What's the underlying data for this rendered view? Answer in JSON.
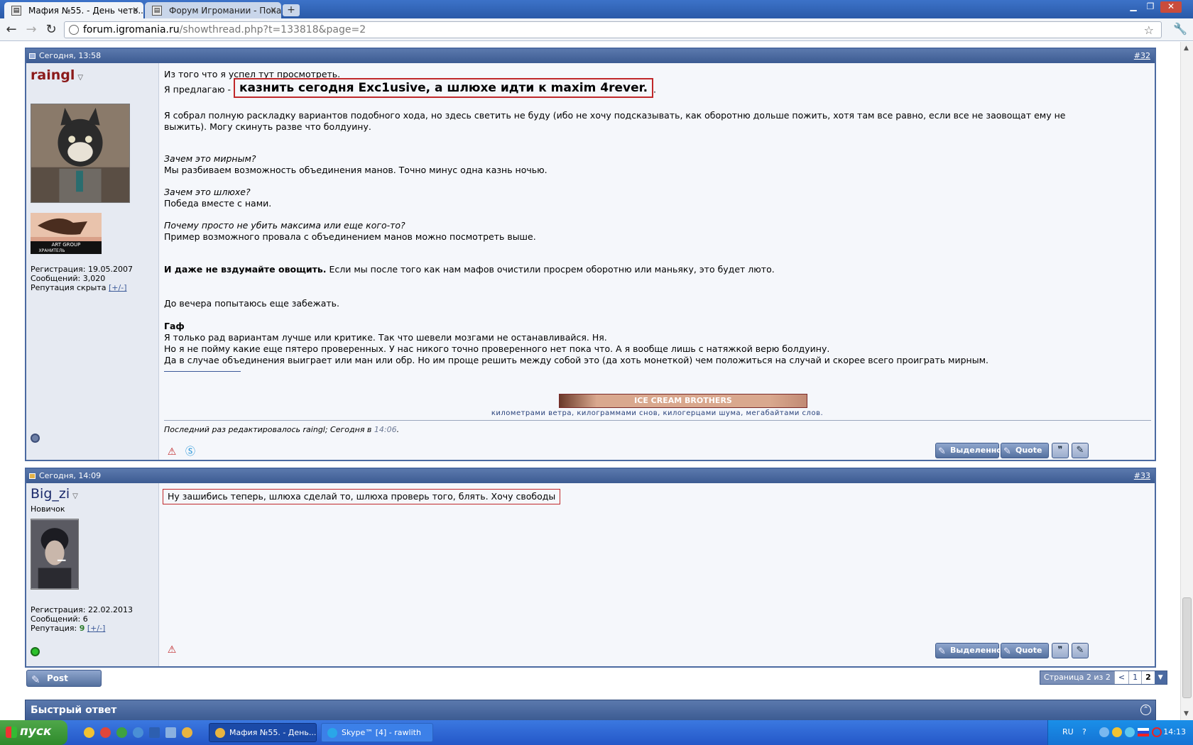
{
  "browser": {
    "tabs": [
      {
        "label": "Мафия №55. - День четв..."
      },
      {
        "label": "Форум Игромании - Показ..."
      }
    ],
    "url_host": "forum.igromania.ru",
    "url_path": "/showthread.php?t=133818&page=2"
  },
  "posts": [
    {
      "date": "Сегодня, 13:58",
      "number": "#32",
      "user": {
        "name": "raingl",
        "registration": "Регистрация: 19.05.2007",
        "messages": "Сообщений: 3,020",
        "reputation_label": "Репутация скрыта",
        "reputation_link": "[+/-]",
        "online": false
      },
      "lines": {
        "l1": "Из того что я успел тут просмотреть.",
        "l2_prefix": "Я предлагаю -",
        "l2_highlight": "казнить сегодня Exc1usive, а шлюхе идти к maxim 4rever.",
        "l2_suffix": ".",
        "l3": "Я собрал полную раскладку вариантов подобного хода, но здесь светить не буду (ибо не хочу подсказывать, как оборотню дольше пожить, хотя там все равно, если все не заовощат ему не",
        "l4": "выжить). Могу скинуть разве что болдуину.",
        "q1": "Зачем это мирным?",
        "a1": "Мы разбиваем возможность объединения манов. Точно минус одна казнь ночью.",
        "q2": "Зачем это шлюхе?",
        "a2": "Победа вместе с нами.",
        "q3": "Почему просто не убить максима или еще кого-то?",
        "a3": "Пример возможного провала с объединением манов можно посмотреть выше.",
        "bold": "И даже не вздумайте овощить.",
        "bold_rest": " Если мы после того как нам мафов очистили просрем оборотню или маньяку, это будет люто.",
        "evening": "До вечера попытаюсь еще забежать.",
        "gaf": "Гаф",
        "g1": "Я только рад вариантам лучше или критике. Так что шевели мозгами не останавливайся. Ня.",
        "g2": "Но я не пойму какие еще пятеро проверенных. У нас никого точно проверенного нет пока что. А я вообще лишь с натяжкой верю болдуину.",
        "g3": "Да в случае объединения выиграет или ман или обр. Но им проще решить между собой это (да хоть монеткой) чем положиться на случай и скорее всего проиграть мирным."
      },
      "signature_banner": "ICE CREAM BROTHERS",
      "signature_text": "километрами ветра, килограммами снов, килогерцами шума, мегабайтами слов.",
      "banner_text_1": "ART GROUP",
      "banner_text_2": "ХРАНИТЕЛЬ",
      "edited_prefix": "Последний раз редактировалось raingl; Сегодня в ",
      "edited_time": "14:06",
      "edited_suffix": "."
    },
    {
      "date": "Сегодня, 14:09",
      "number": "#33",
      "user": {
        "name": "Big_zi",
        "title": "Новичок",
        "registration": "Регистрация: 22.02.2013",
        "messages": "Сообщений: 6",
        "reputation_label": "Репутация: ",
        "reputation_value": "9",
        "reputation_link": "[+/-]",
        "online": true
      },
      "text": "Ну зашибись теперь, шлюха сделай то, шлюха проверь того, блять. Хочу свободы"
    }
  ],
  "buttons": {
    "selected": "Выделенное",
    "quote": "Quote",
    "post_reply": "Post Reply"
  },
  "pagination": {
    "label": "Страница 2 из 2",
    "prev": "<",
    "p1": "1",
    "p2": "2"
  },
  "quick_reply": "Быстрый ответ",
  "taskbar": {
    "start": "пуск",
    "items": [
      "Мафия №55. - День...",
      "Skype™ [4] - rawlith"
    ],
    "lang": "RU",
    "clock": "14:13"
  },
  "colors": {
    "accent": "#3c5b92",
    "highlight_border": "#c0282a",
    "username": "#8b1a1a"
  }
}
